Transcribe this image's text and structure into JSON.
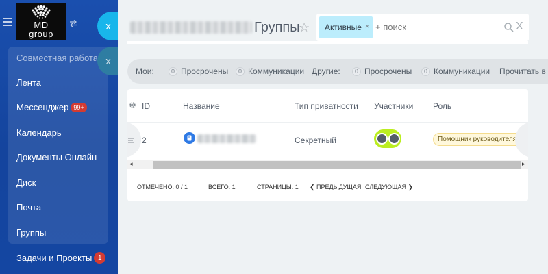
{
  "logo": {
    "text": "MD\ngroup"
  },
  "sidebar": {
    "group_title": "Совместная работа ^",
    "items": [
      {
        "label": "Лента"
      },
      {
        "label": "Мессенджер",
        "badge": "99+"
      },
      {
        "label": "Календарь"
      },
      {
        "label": "Документы Онлайн"
      },
      {
        "label": "Диск"
      },
      {
        "label": "Почта"
      },
      {
        "label": "Группы"
      },
      {
        "label": "Задачи и Проекты",
        "badge": "1"
      }
    ]
  },
  "slider_close": {
    "label": "x"
  },
  "header": {
    "title": "Группы"
  },
  "search": {
    "tag_label": "Активные",
    "tag_remove": "×",
    "placeholder": "+ поиск",
    "clear": "X"
  },
  "counters": {
    "mine_label": "Мои:",
    "others_label": "Другие:",
    "items": [
      {
        "count": "0",
        "label": "Просрочены"
      },
      {
        "count": "0",
        "label": "Коммуникации"
      },
      {
        "count": "0",
        "label": "Просрочены"
      },
      {
        "count": "0",
        "label": "Коммуникации"
      }
    ],
    "read_all": "Прочитать в"
  },
  "grid": {
    "columns": [
      "ID",
      "Название",
      "Тип приватности",
      "Участники",
      "Роль"
    ],
    "rows": [
      {
        "id": "2",
        "privacy": "Секретный",
        "role": "Помощник руководителя проект"
      }
    ],
    "scroll_left": "◂",
    "scroll_right": "▸"
  },
  "footer": {
    "selected": "ОТМЕЧЕНО: 0 / 1",
    "total": "ВСЕГО: 1",
    "pages": "СТРАНИЦЫ:  1",
    "prev": "❮  ПРЕДЫДУЩАЯ",
    "next": "СЛЕДУЮЩАЯ  ❯"
  },
  "colors": {
    "sidebar": "#1a4fae",
    "accent": "#18b6eb",
    "members_badge": "#bbed21",
    "role_bg": "#fff8dc"
  }
}
